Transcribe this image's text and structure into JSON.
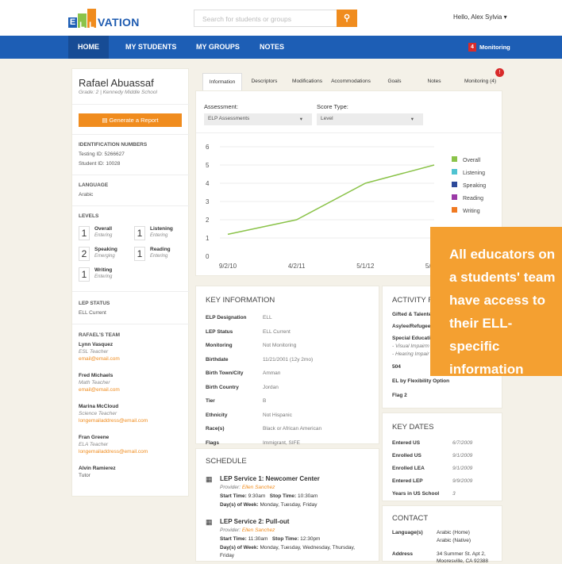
{
  "header": {
    "logo_text": "VATION",
    "logo_blocks": [
      "E",
      "L",
      "L",
      "E"
    ],
    "search_placeholder": "Search for students or groups",
    "greeting": "Hello, Alex Sylvia",
    "caret": "▾"
  },
  "nav": {
    "items": [
      "HOME",
      "MY STUDENTS",
      "MY GROUPS",
      "NOTES"
    ],
    "monitoring_count": "4",
    "monitoring_label": "Monitoring"
  },
  "student": {
    "name": "Rafael Abuassaf",
    "grade": "Grade: 2 | Kennedy Middle School",
    "report_button": "Generate a Report",
    "id_heading": "IDENTIFICATION NUMBERS",
    "testing_id": "Testing ID: 5266627",
    "student_id": "Student ID: 10028",
    "lang_heading": "LANGUAGE",
    "language": "Arabic",
    "levels_heading": "LEVELS",
    "levels": [
      {
        "num": "1",
        "name": "Overall",
        "status": "Entering"
      },
      {
        "num": "1",
        "name": "Listening",
        "status": "Entering"
      },
      {
        "num": "2",
        "name": "Speaking",
        "status": "Emerging"
      },
      {
        "num": "1",
        "name": "Reading",
        "status": "Entering"
      },
      {
        "num": "1",
        "name": "Writing",
        "status": "Entering"
      }
    ],
    "lep_heading": "LEP STATUS",
    "lep": "ELL Current",
    "team_heading": "RAFAEL'S TEAM",
    "team": [
      {
        "name": "Lynn Vasquez",
        "role": "ESL Teacher",
        "email": "email@email.com"
      },
      {
        "name": "Fred Michaels",
        "role": "Math Teacher",
        "email": "email@email.com"
      },
      {
        "name": "Marina McCloud",
        "role": "Science Teacher",
        "email": "longemailaddress@email.com"
      },
      {
        "name": "Fran Greene",
        "role": "ELA Teacher",
        "email": "longemailaddress@email.com"
      },
      {
        "name": "Alvin Ramierez",
        "role": "Tutor",
        "email": ""
      }
    ]
  },
  "tabs": [
    "Information",
    "Descriptors",
    "Modifications",
    "Accommodations",
    "Goals",
    "Notes",
    "Monitoring (4)"
  ],
  "filters": {
    "assessment_label": "Assessment:",
    "assessment_value": "ELP Assessments",
    "score_label": "Score Type:",
    "score_value": "Level",
    "caret": "▾"
  },
  "chart_data": {
    "type": "line",
    "categories": [
      "9/2/10",
      "4/2/11",
      "5/1/12",
      "5/9/13"
    ],
    "ylim": [
      0,
      6
    ],
    "yticks": [
      "0",
      "1",
      "2",
      "3",
      "4",
      "5",
      "6"
    ],
    "series": [
      {
        "name": "Overall",
        "values": [
          1.2,
          2,
          4,
          5
        ],
        "color": "#8bc34a"
      }
    ],
    "legend": [
      {
        "name": "Overall",
        "color": "#8bc34a"
      },
      {
        "name": "Listening",
        "color": "#4fc3d1"
      },
      {
        "name": "Speaking",
        "color": "#2d4a9a"
      },
      {
        "name": "Reading",
        "color": "#9b3aa7"
      },
      {
        "name": "Writing",
        "color": "#f07a22"
      }
    ]
  },
  "key_info": {
    "heading": "KEY INFORMATION",
    "rows": [
      [
        "ELP Designation",
        "ELL"
      ],
      [
        "LEP Status",
        "ELL Current"
      ],
      [
        "Monitoring",
        "Not Monitoring"
      ],
      [
        "Birthdate",
        "11/21/2001 (12y 2mo)"
      ],
      [
        "Birth Town/City",
        "Amman"
      ],
      [
        "Birth Country",
        "Jordan"
      ],
      [
        "Tier",
        "B"
      ],
      [
        "Ethnicity",
        "Not Hispanic"
      ],
      [
        "Race(s)",
        "Black or African American"
      ],
      [
        "Flags",
        "Immigrant, SIFE"
      ]
    ]
  },
  "schedule": {
    "heading": "SCHEDULE",
    "items": [
      {
        "title": "LEP Service 1: Newcomer Center",
        "provider_label": "Provider: ",
        "provider": "Ellen Sanchez",
        "start_label": "Start Time: ",
        "start": "9:30am",
        "stop_label": "Stop Time: ",
        "stop": "10:30am",
        "days_label": "Day(s) of Week: ",
        "days": "Monday, Tuesday, Friday"
      },
      {
        "title": "LEP Service 2: Pull-out",
        "provider_label": "Provider: ",
        "provider": "Ellen Sanchez",
        "start_label": "Start Time: ",
        "start": "11:30am",
        "stop_label": "Stop Time: ",
        "stop": "12:30pm",
        "days_label": "Day(s) of Week: ",
        "days": "Monday, Tuesday, Wednesday, Thursday,",
        "days2": "Friday"
      }
    ]
  },
  "activity": {
    "heading": "ACTIVITY F",
    "items": [
      "Gifted & Talente",
      "Asylee/Refugee",
      "Special Educatio",
      "- Visual Impairm",
      "- Hearing Impair",
      "504",
      "EL by Flexibility Option",
      "Flag 2"
    ]
  },
  "key_dates": {
    "heading": "KEY DATES",
    "rows": [
      [
        "Entered US",
        "6/7/2009"
      ],
      [
        "Enrolled US",
        "9/1/2009"
      ],
      [
        "Enrolled LEA",
        "9/1/2009"
      ],
      [
        "Entered LEP",
        "9/9/2009"
      ],
      [
        "Years in US School",
        "3"
      ]
    ]
  },
  "contact": {
    "heading": "CONTACT",
    "lang_label": "Language(s)",
    "lang1": "Arabic (Home)",
    "lang2": "Arabic (Native)",
    "addr_label": "Address",
    "addr1": "34 Summer St. Apt 2,",
    "addr2": "Mooresville, CA 92388"
  },
  "callout": {
    "lines": [
      "All educators on",
      "a students' team",
      "have access to",
      "their ELL-specific",
      "information"
    ]
  }
}
